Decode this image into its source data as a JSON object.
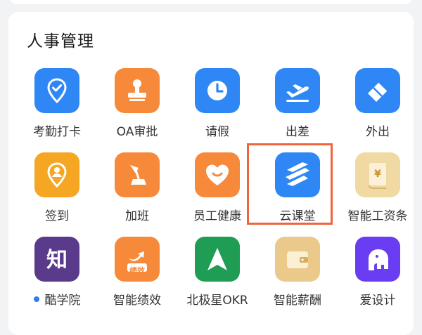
{
  "section": {
    "title": "人事管理"
  },
  "highlight_color": "#f0643c",
  "apps": [
    {
      "label": "考勤打卡",
      "icon": "location-check-icon",
      "color": "#2f87f5"
    },
    {
      "label": "OA审批",
      "icon": "stamp-icon",
      "color": "#f6893a"
    },
    {
      "label": "请假",
      "icon": "clock-icon",
      "color": "#2f87f5"
    },
    {
      "label": "出差",
      "icon": "airplane-icon",
      "color": "#2f87f5"
    },
    {
      "label": "外出",
      "icon": "eraser-icon",
      "color": "#2f87f5"
    },
    {
      "label": "签到",
      "icon": "location-person-icon",
      "color": "#f5a623"
    },
    {
      "label": "加班",
      "icon": "desk-lamp-icon",
      "color": "#f6893a"
    },
    {
      "label": "员工健康",
      "icon": "heart-smile-icon",
      "color": "#f6893a"
    },
    {
      "label": "云课堂",
      "icon": "stripes-logo-icon",
      "color": "#2f87f5"
    },
    {
      "label": "智能工资条",
      "icon": "yen-scroll-icon",
      "color": "#f0d9a3"
    },
    {
      "label": "酷学院",
      "icon": "zhi-logo-icon",
      "color": "#5a3a8a",
      "badge": true,
      "badge_color": "#2f7cf6"
    },
    {
      "label": "智能绩效",
      "icon": "performance-arrow-icon",
      "color": "#f6893a",
      "icon_text": "绩效"
    },
    {
      "label": "北极星OKR",
      "icon": "north-star-arrow-icon",
      "color": "#1f9d55"
    },
    {
      "label": "智能薪酬",
      "icon": "wallet-icon",
      "color": "#eac98a"
    },
    {
      "label": "爱设计",
      "icon": "elephant-icon",
      "color": "#6a3cf2"
    }
  ]
}
